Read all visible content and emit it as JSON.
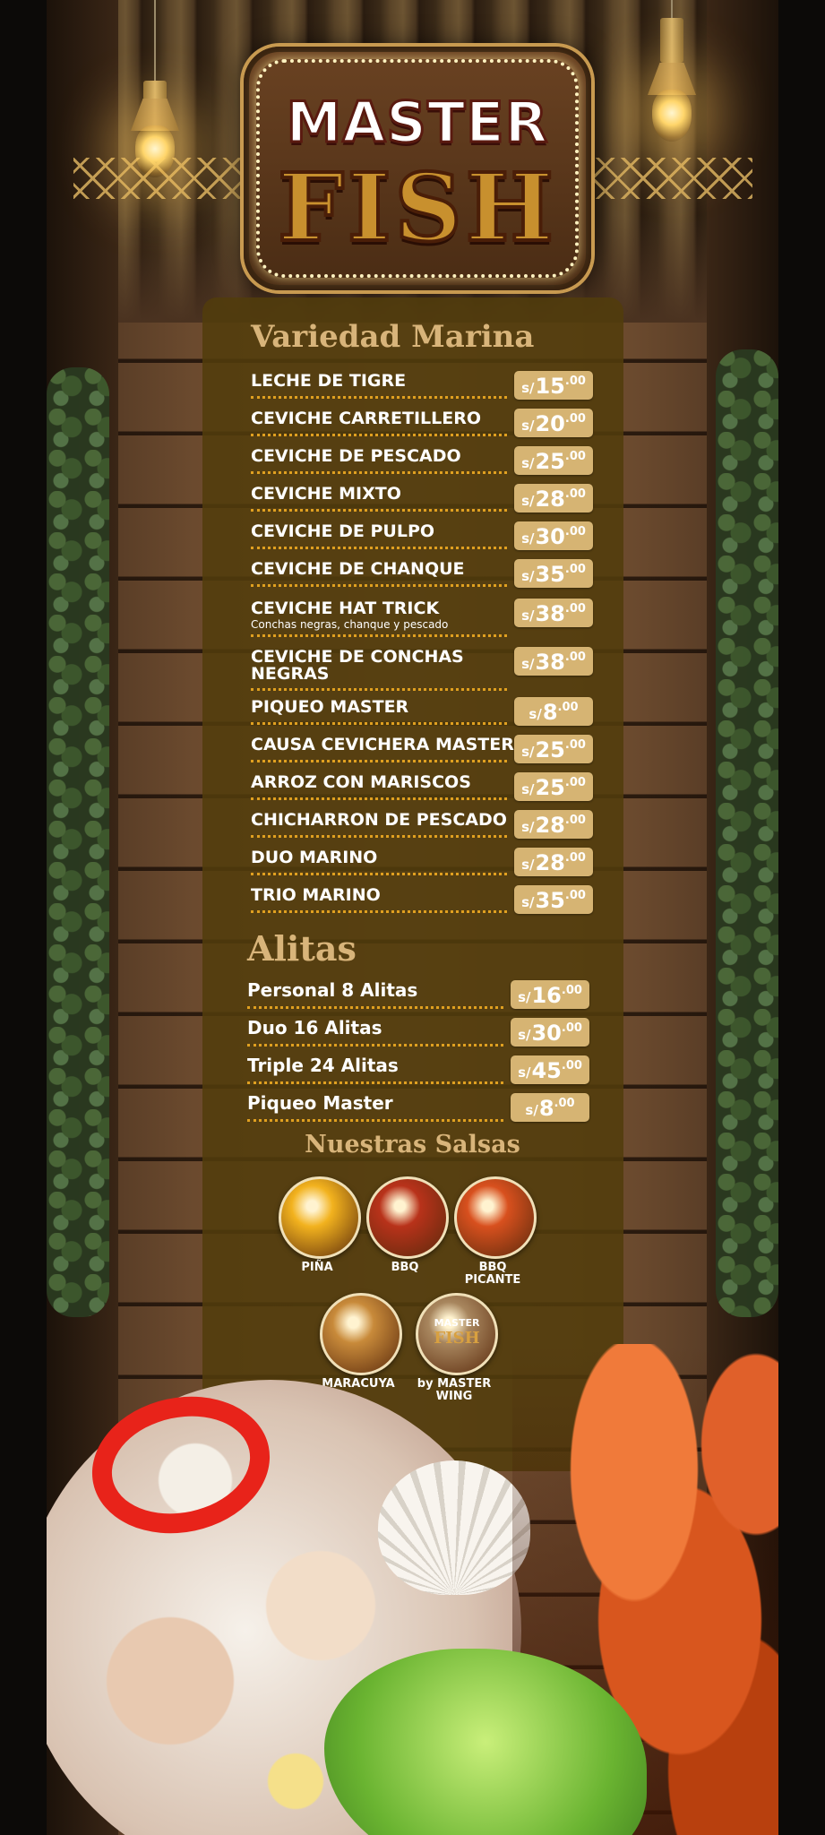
{
  "brand": {
    "line1": "MASTER",
    "line2": "FISH"
  },
  "marina": {
    "title": "Variedad Marina",
    "items": [
      {
        "name": "LECHE DE TIGRE",
        "currency": "s/",
        "amount": "15",
        "cents": ".00"
      },
      {
        "name": "CEVICHE CARRETILLERO",
        "currency": "s/",
        "amount": "20",
        "cents": ".00"
      },
      {
        "name": "CEVICHE DE PESCADO",
        "currency": "s/",
        "amount": "25",
        "cents": ".00"
      },
      {
        "name": "CEVICHE MIXTO",
        "currency": "s/",
        "amount": "28",
        "cents": ".00"
      },
      {
        "name": "CEVICHE DE PULPO",
        "currency": "s/",
        "amount": "30",
        "cents": ".00"
      },
      {
        "name": "CEVICHE DE CHANQUE",
        "currency": "s/",
        "amount": "35",
        "cents": ".00"
      },
      {
        "name": "CEVICHE HAT TRICK",
        "sub": "Conchas negras, chanque y pescado",
        "currency": "s/",
        "amount": "38",
        "cents": ".00"
      },
      {
        "name": "CEVICHE DE CONCHAS",
        "name2": "NEGRAS",
        "currency": "s/",
        "amount": "38",
        "cents": ".00"
      },
      {
        "name": "PIQUEO MASTER",
        "currency": "s/",
        "amount": "8",
        "cents": ".00"
      },
      {
        "name": "CAUSA CEVICHERA MASTER",
        "currency": "s/",
        "amount": "25",
        "cents": ".00"
      },
      {
        "name": "ARROZ CON MARISCOS",
        "currency": "s/",
        "amount": "25",
        "cents": ".00"
      },
      {
        "name": "CHICHARRON DE PESCADO",
        "currency": "s/",
        "amount": "28",
        "cents": ".00"
      },
      {
        "name": "DUO MARINO",
        "currency": "s/",
        "amount": "28",
        "cents": ".00"
      },
      {
        "name": "TRIO MARINO",
        "currency": "s/",
        "amount": "35",
        "cents": ".00"
      }
    ]
  },
  "alitas": {
    "title": "Alitas",
    "items": [
      {
        "name": "Personal 8 Alitas",
        "currency": "s/",
        "amount": "16",
        "cents": ".00"
      },
      {
        "name": "Duo 16 Alitas",
        "currency": "s/",
        "amount": "30",
        "cents": ".00"
      },
      {
        "name": "Triple 24 Alitas",
        "currency": "s/",
        "amount": "45",
        "cents": ".00"
      },
      {
        "name": "Piqueo Master",
        "currency": "s/",
        "amount": "8",
        "cents": ".00"
      }
    ]
  },
  "salsas": {
    "title": "Nuestras Salsas",
    "items": [
      {
        "label": "PIÑA",
        "color": "#f2b21e"
      },
      {
        "label": "BBQ",
        "color": "#b8321a"
      },
      {
        "label": "BBQ",
        "label2": "PICANTE",
        "color": "#d8501e"
      },
      {
        "label": "MARACUYA",
        "color": "#c88a3a"
      },
      {
        "label": "by MASTER",
        "label2": "WING",
        "color": "#a8865e",
        "logo1": "MASTER",
        "logo2": "FISH"
      }
    ]
  }
}
